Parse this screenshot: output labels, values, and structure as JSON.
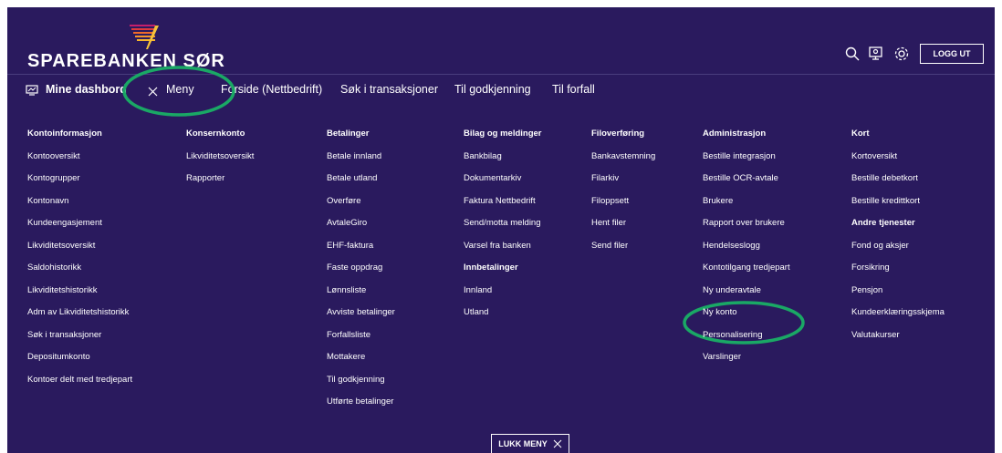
{
  "brand": {
    "name": "SPAREBANKEN SØR"
  },
  "header": {
    "logout_label": "LOGG UT"
  },
  "nav": {
    "dashboards": "Mine dashbord",
    "menu": "Meny",
    "items": [
      "Forside (Nettbedrift)",
      "Søk i transaksjoner",
      "Til godkjenning",
      "Til forfall"
    ]
  },
  "menu": {
    "columns": [
      {
        "items": [
          {
            "label": "Kontoinformasjon",
            "heading": true
          },
          {
            "label": "Kontooversikt"
          },
          {
            "label": "Kontogrupper"
          },
          {
            "label": "Kontonavn"
          },
          {
            "label": "Kundeengasjement"
          },
          {
            "label": "Likviditetsoversikt"
          },
          {
            "label": "Saldohistorikk"
          },
          {
            "label": "Likviditetshistorikk"
          },
          {
            "label": "Adm av Likviditetshistorikk"
          },
          {
            "label": "Søk i transaksjoner"
          },
          {
            "label": "Depositumkonto"
          },
          {
            "label": "Kontoer delt med tredjepart"
          }
        ]
      },
      {
        "items": [
          {
            "label": "Konsernkonto",
            "heading": true
          },
          {
            "label": "Likviditetsoversikt"
          },
          {
            "label": "Rapporter"
          }
        ]
      },
      {
        "items": [
          {
            "label": "Betalinger",
            "heading": true
          },
          {
            "label": "Betale innland"
          },
          {
            "label": "Betale utland"
          },
          {
            "label": "Overføre"
          },
          {
            "label": "AvtaleGiro"
          },
          {
            "label": "EHF-faktura"
          },
          {
            "label": "Faste oppdrag"
          },
          {
            "label": "Lønnsliste"
          },
          {
            "label": "Avviste betalinger"
          },
          {
            "label": "Forfallsliste"
          },
          {
            "label": "Mottakere"
          },
          {
            "label": "Til godkjenning"
          },
          {
            "label": "Utførte betalinger"
          }
        ]
      },
      {
        "items": [
          {
            "label": "Bilag og meldinger",
            "heading": true
          },
          {
            "label": "Bankbilag"
          },
          {
            "label": "Dokumentarkiv"
          },
          {
            "label": "Faktura Nettbedrift"
          },
          {
            "label": "Send/motta melding"
          },
          {
            "label": "Varsel fra banken"
          },
          {
            "label": "Innbetalinger",
            "heading": true
          },
          {
            "label": "Innland"
          },
          {
            "label": "Utland"
          }
        ]
      },
      {
        "items": [
          {
            "label": "Filoverføring",
            "heading": true
          },
          {
            "label": "Bankavstemning"
          },
          {
            "label": "Filarkiv"
          },
          {
            "label": "Filoppsett"
          },
          {
            "label": "Hent filer"
          },
          {
            "label": "Send filer"
          }
        ]
      },
      {
        "items": [
          {
            "label": "Administrasjon",
            "heading": true
          },
          {
            "label": "Bestille integrasjon"
          },
          {
            "label": "Bestille OCR-avtale"
          },
          {
            "label": "Brukere"
          },
          {
            "label": "Rapport over brukere"
          },
          {
            "label": "Hendelseslogg"
          },
          {
            "label": "Kontotilgang tredjepart"
          },
          {
            "label": "Ny underavtale"
          },
          {
            "label": "Ny konto"
          },
          {
            "label": "Personalisering"
          },
          {
            "label": "Varslinger"
          }
        ]
      },
      {
        "items": [
          {
            "label": "Kort",
            "heading": true
          },
          {
            "label": "Kortoversikt"
          },
          {
            "label": "Bestille debetkort"
          },
          {
            "label": "Bestille kredittkort"
          },
          {
            "label": "Andre tjenester",
            "heading": true
          },
          {
            "label": "Fond og aksjer"
          },
          {
            "label": "Forsikring"
          },
          {
            "label": "Pensjon"
          },
          {
            "label": "Kundeerklæringsskjema"
          },
          {
            "label": "Valutakurser"
          }
        ]
      }
    ],
    "close_label": "LUKK MENY"
  },
  "colors": {
    "background": "#2a1a5e",
    "text": "#ffffff",
    "annotation": "#1aa865"
  },
  "icons": [
    "logo-mark-icon",
    "search-icon",
    "dashboard-icon",
    "settings-icon",
    "close-icon"
  ]
}
